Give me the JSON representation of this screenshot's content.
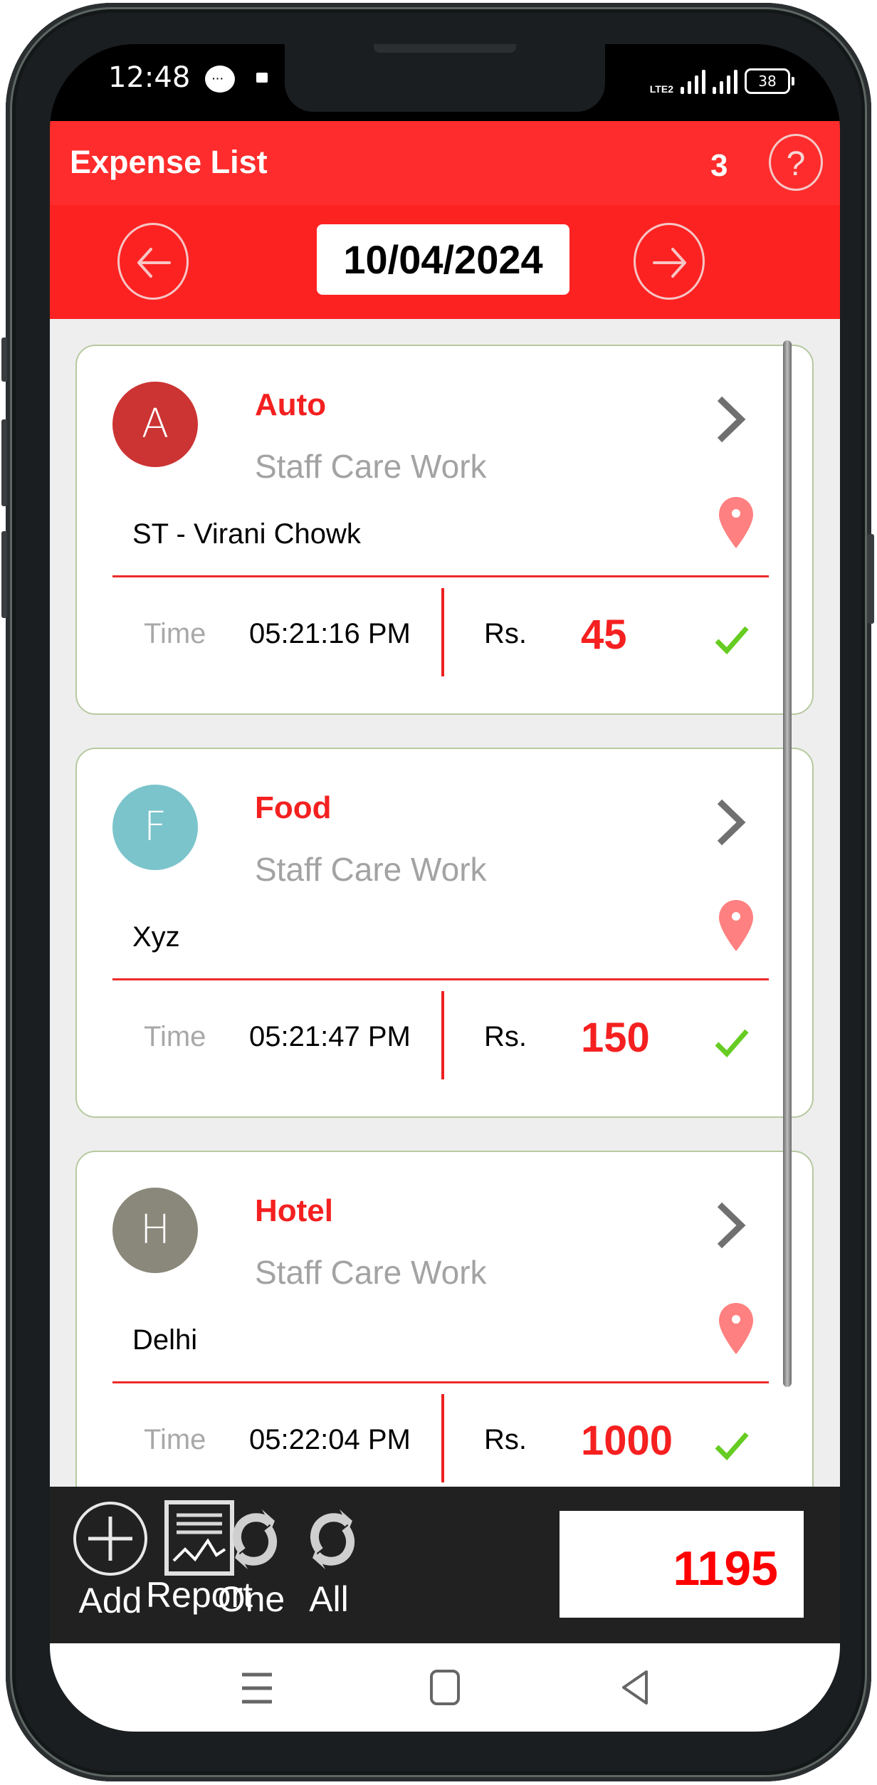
{
  "status_bar": {
    "time": "12:48",
    "network_label": "LTE2",
    "battery": "38",
    "icons": [
      "message-icon",
      "media-icon",
      "lte-icon",
      "signal-icon",
      "signal-icon",
      "battery-icon"
    ]
  },
  "header": {
    "title": "Expense List",
    "count": "3",
    "help_icon": "?"
  },
  "date_nav": {
    "date": "10/04/2024",
    "prev_icon": "arrow-left-icon",
    "next_icon": "arrow-right-icon"
  },
  "expenses": [
    {
      "initial": "A",
      "avatar_color": "#cc3333",
      "category": "Auto",
      "subtitle": "Staff Care Work",
      "place": "ST - Virani Chowk",
      "time_label": "Time",
      "time": "05:21:16 PM",
      "currency": "Rs.",
      "amount": "45"
    },
    {
      "initial": "F",
      "avatar_color": "#7bc4cb",
      "category": "Food",
      "subtitle": "Staff Care Work",
      "place": "Xyz",
      "time_label": "Time",
      "time": "05:21:47 PM",
      "currency": "Rs.",
      "amount": "150"
    },
    {
      "initial": "H",
      "avatar_color": "#8a887a",
      "category": "Hotel",
      "subtitle": "Staff Care Work",
      "place": "Delhi",
      "time_label": "Time",
      "time": "05:22:04 PM",
      "currency": "Rs.",
      "amount": "1000"
    }
  ],
  "toolbar": {
    "add_label": "Add",
    "report_label": "Report",
    "one_label": "One",
    "all_label": "All",
    "total": "1195"
  },
  "colors": {
    "accent": "#fe2c2c",
    "amount": "#f52020",
    "check": "#66cc22",
    "pin": "#ff8080",
    "toolbar_bg": "#212121"
  }
}
